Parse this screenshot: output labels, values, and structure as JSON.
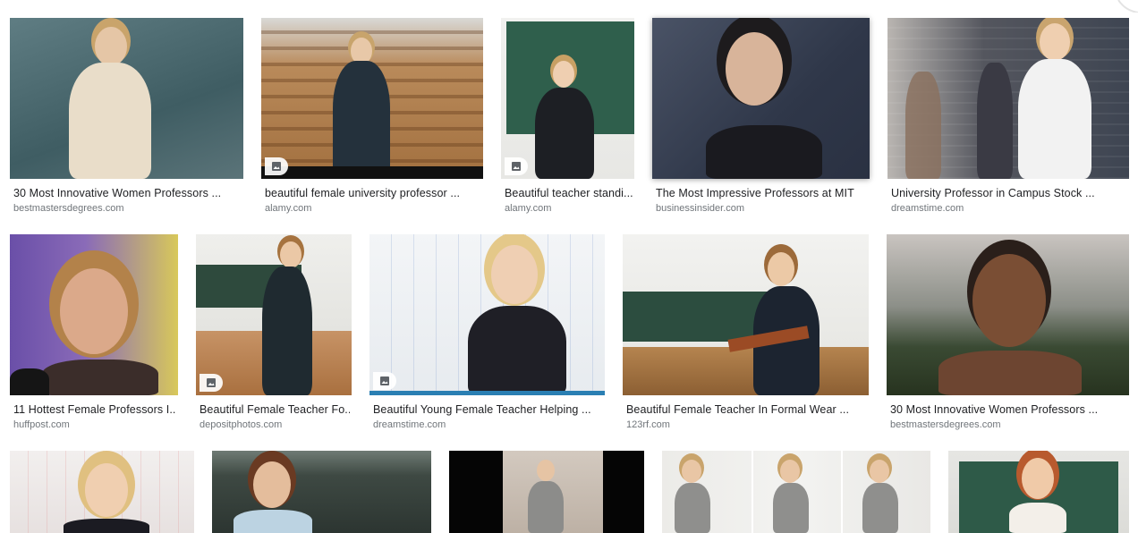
{
  "results": [
    {
      "caption": "30 Most Innovative Women Professors ...",
      "source": "bestmastersdegrees.com",
      "has_image_badge": false
    },
    {
      "caption": "beautiful female university professor ...",
      "source": "alamy.com",
      "has_image_badge": true
    },
    {
      "caption": "Beautiful teacher standi...",
      "source": "alamy.com",
      "has_image_badge": true
    },
    {
      "caption": "The Most Impressive Professors at MIT",
      "source": "businessinsider.com",
      "has_image_badge": false
    },
    {
      "caption": "University Professor in Campus Stock ...",
      "source": "dreamstime.com",
      "has_image_badge": false
    },
    {
      "caption": "11 Hottest Female Professors I...",
      "source": "huffpost.com",
      "has_image_badge": false
    },
    {
      "caption": "Beautiful Female Teacher Fo...",
      "source": "depositphotos.com",
      "has_image_badge": true
    },
    {
      "caption": "Beautiful Young Female Teacher Helping ...",
      "source": "dreamstime.com",
      "has_image_badge": true
    },
    {
      "caption": "Beautiful Female Teacher In Formal Wear ...",
      "source": "123rf.com",
      "has_image_badge": false
    },
    {
      "caption": "30 Most Innovative Women Professors ...",
      "source": "bestmastersdegrees.com",
      "has_image_badge": false
    },
    {
      "caption": "",
      "source": "",
      "has_image_badge": false
    },
    {
      "caption": "",
      "source": "",
      "has_image_badge": false
    },
    {
      "caption": "",
      "source": "",
      "has_image_badge": false
    },
    {
      "caption": "",
      "source": "",
      "has_image_badge": false
    },
    {
      "caption": "",
      "source": "",
      "has_image_badge": false
    }
  ],
  "icons": {
    "image_badge": "image-icon"
  }
}
